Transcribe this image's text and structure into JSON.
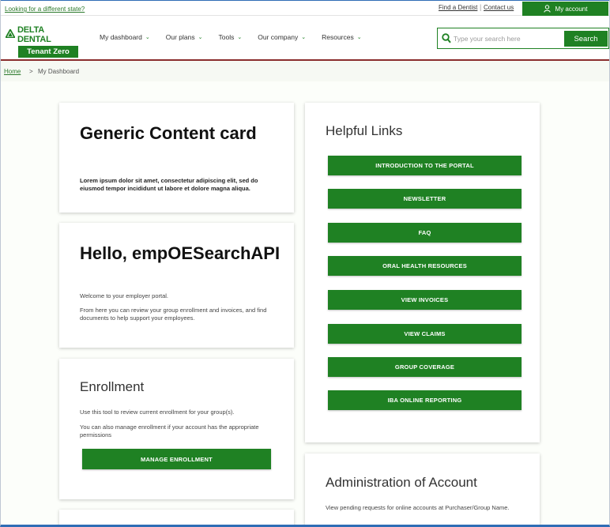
{
  "utility": {
    "state_link": "Looking for a different state?",
    "find_dentist": "Find a Dentist",
    "contact_us": "Contact us",
    "my_account": "My account"
  },
  "brand": {
    "name": "DELTA DENTAL",
    "tenant": "Tenant Zero",
    "accent_color": "#1f8123"
  },
  "nav": {
    "items": [
      {
        "label": "My dashboard"
      },
      {
        "label": "Our plans"
      },
      {
        "label": "Tools"
      },
      {
        "label": "Our company"
      },
      {
        "label": "Resources"
      }
    ]
  },
  "search": {
    "placeholder": "Type your search here",
    "button": "Search"
  },
  "breadcrumb": {
    "home": "Home",
    "separator": ">",
    "current": "My Dashboard"
  },
  "generic_card": {
    "title": "Generic Content card",
    "body": "Lorem ipsum dolor sit amet, consectetur adipiscing elit, sed do eiusmod tempor incididunt ut labore et dolore magna aliqua."
  },
  "hello_card": {
    "title": "Hello, empOESearchAPI",
    "welcome": "Welcome to your employer portal.",
    "body": "From here you can review your group enrollment and invoices, and find documents to help support your employees."
  },
  "enrollment_card": {
    "title": "Enrollment",
    "text1": "Use this tool to review current enrollment for your group(s).",
    "text2": "You can also manage enrollment if your account has the appropriate permissions",
    "button": "MANAGE ENROLLMENT"
  },
  "helpful_links": {
    "title": "Helpful Links",
    "links": [
      {
        "label": "INTRODUCTION TO THE PORTAL"
      },
      {
        "label": "NEWSLETTER"
      },
      {
        "label": "FAQ"
      },
      {
        "label": "ORAL HEALTH RESOURCES"
      },
      {
        "label": "VIEW INVOICES"
      },
      {
        "label": "VIEW CLAIMS"
      },
      {
        "label": "GROUP COVERAGE"
      },
      {
        "label": "IBA ONLINE REPORTING"
      }
    ]
  },
  "admin_card": {
    "title": "Administration of Account",
    "text": "View pending requests for online accounts at Purchaser/Group Name."
  }
}
